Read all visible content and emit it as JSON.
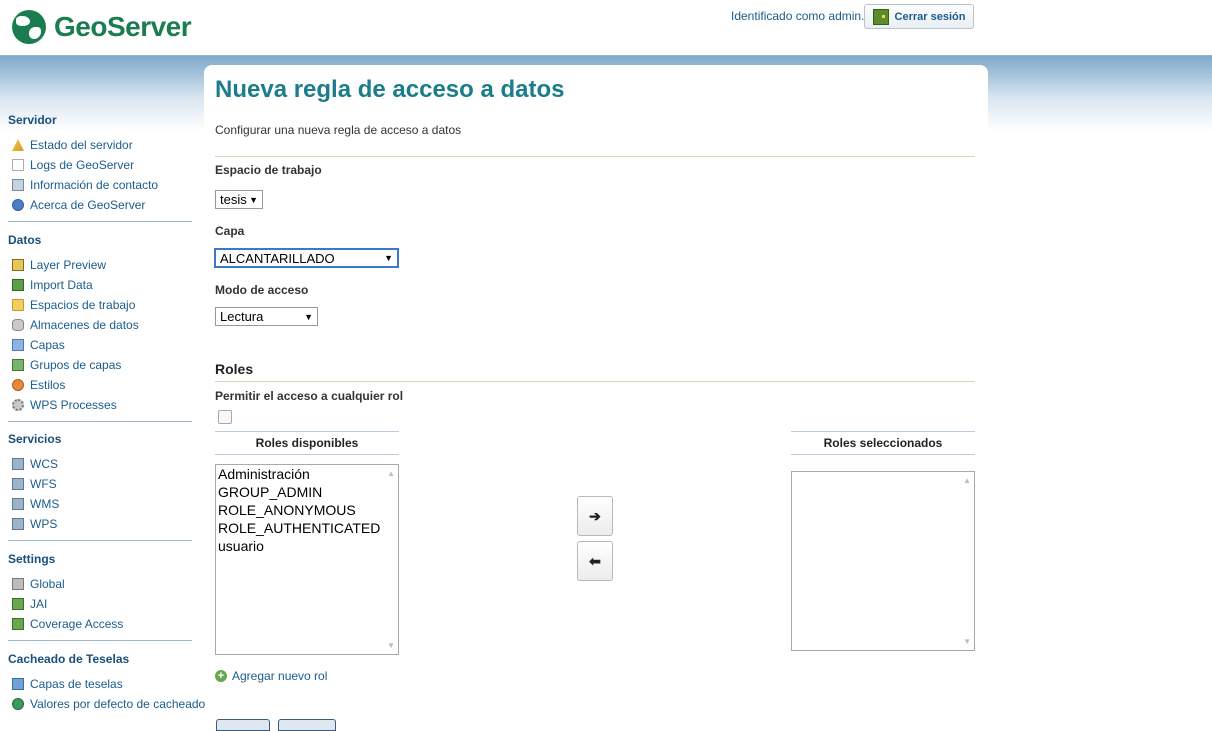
{
  "app": {
    "brand": "GeoServer"
  },
  "header": {
    "login_text": "Identificado como admin.",
    "logout_label": "Cerrar sesión"
  },
  "page": {
    "title": "Nueva regla de acceso a datos",
    "description": "Configurar una nueva regla de acceso a datos"
  },
  "form": {
    "workspace_label": "Espacio de trabajo",
    "workspace_value": "tesis",
    "layer_label": "Capa",
    "layer_value": "ALCANTARILLADO",
    "access_mode_label": "Modo de acceso",
    "access_mode_value": "Lectura",
    "roles_section": "Roles",
    "any_role_label": "Permitir el acceso a cualquier rol",
    "any_role_checked": false,
    "available_header": "Roles disponibles",
    "selected_header": "Roles seleccionados",
    "available_roles": [
      "Administración",
      "GROUP_ADMIN",
      "ROLE_ANONYMOUS",
      "ROLE_AUTHENTICATED",
      "usuario"
    ],
    "selected_roles": [],
    "add_right_symbol": "➔",
    "add_left_symbol": "⬅",
    "add_role_label": "Agregar nuevo rol"
  },
  "sidebar": {
    "sections": [
      {
        "title": "Servidor",
        "items": [
          {
            "label": "Estado del servidor",
            "icon": "warning-icon"
          },
          {
            "label": "Logs de GeoServer",
            "icon": "document-icon"
          },
          {
            "label": "Información de contacto",
            "icon": "contact-card-icon"
          },
          {
            "label": "Acerca de GeoServer",
            "icon": "info-icon"
          }
        ]
      },
      {
        "title": "Datos",
        "items": [
          {
            "label": "Layer Preview",
            "icon": "layer-preview-icon"
          },
          {
            "label": "Import Data",
            "icon": "import-icon"
          },
          {
            "label": "Espacios de trabajo",
            "icon": "folder-icon"
          },
          {
            "label": "Almacenes de datos",
            "icon": "database-icon"
          },
          {
            "label": "Capas",
            "icon": "layers-icon"
          },
          {
            "label": "Grupos de capas",
            "icon": "layer-group-icon"
          },
          {
            "label": "Estilos",
            "icon": "style-icon"
          },
          {
            "label": "WPS Processes",
            "icon": "gear-icon"
          }
        ]
      },
      {
        "title": "Servicios",
        "items": [
          {
            "label": "WCS",
            "icon": "service-icon"
          },
          {
            "label": "WFS",
            "icon": "service-icon"
          },
          {
            "label": "WMS",
            "icon": "service-icon"
          },
          {
            "label": "WPS",
            "icon": "service-icon"
          }
        ]
      },
      {
        "title": "Settings",
        "items": [
          {
            "label": "Global",
            "icon": "global-settings-icon"
          },
          {
            "label": "JAI",
            "icon": "jai-icon"
          },
          {
            "label": "Coverage Access",
            "icon": "coverage-icon"
          }
        ]
      },
      {
        "title": "Cacheado de Teselas",
        "items": [
          {
            "label": "Capas de teselas",
            "icon": "tile-layers-icon"
          },
          {
            "label": "Valores por defecto de cacheado",
            "icon": "globe-icon"
          }
        ]
      }
    ]
  },
  "colors": {
    "brand_green": "#1b7d4f",
    "title_teal": "#1b7d8a",
    "link_blue": "#1a5c8f",
    "band_blue": "#7fa8c9"
  }
}
